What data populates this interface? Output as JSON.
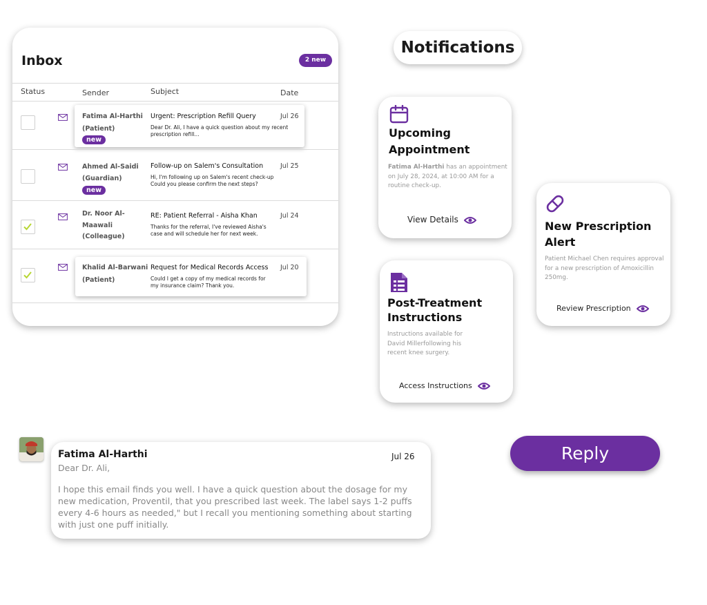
{
  "inbox": {
    "title": "Inbox",
    "badge": "2 new",
    "columns": {
      "status": "Status",
      "sender": "Sender",
      "subject": "Subject",
      "date": "Date"
    },
    "rows": [
      {
        "sender_name": "Fatima Al-Harthi",
        "sender_role": "(Patient)",
        "new_label": "new",
        "subject": "Urgent: Prescription Refill Query",
        "preview": "Dear Dr. Ali, I have a quick question about my recent prescription refill...",
        "date": "Jul 26",
        "checked": false
      },
      {
        "sender_name": "Ahmed Al-Saidi",
        "sender_role": "(Guardian)",
        "new_label": "new",
        "subject": "Follow-up on Salem's Consultation",
        "preview": "Hi, I'm following up on Salem's recent check-up Could you please confirm the next steps?",
        "date": "Jul 25",
        "checked": false
      },
      {
        "sender_name": "Dr. Noor Al-Maawali",
        "sender_role": "(Colleague)",
        "subject": "RE: Patient Referral - Aisha Khan",
        "preview": "Thanks for the referral, I've reviewed Aisha's case and will schedule her for next week.",
        "date": "Jul 24",
        "checked": true
      },
      {
        "sender_name": "Khalid Al-Barwani",
        "sender_role": "(Patient)",
        "subject": "Request for Medical Records Access",
        "preview": "Could I get a copy of my medical records for my insurance claim? Thank you.",
        "date": "Jul 20",
        "checked": true
      }
    ]
  },
  "notifications": {
    "title": "Notifications",
    "cards": [
      {
        "icon": "calendar-icon",
        "title": "Upcoming Appointment",
        "body_name": "Fatima Al-Harthi",
        "body_rest": " has an appointment on July 28, 2024, at 10:00 AM for a routine check-up.",
        "action": "View Details"
      },
      {
        "icon": "pill-icon",
        "title": "New Prescription Alert",
        "body": "Patient Michael Chen requires approval for a new prescription of Amoxicillin 250mg.",
        "action": "Review Prescription"
      },
      {
        "icon": "document-icon",
        "title": "Post-Treatment Instructions",
        "body": "Instructions available for David Millerfollowing his recent knee surgery.",
        "action": "Access Instructions"
      }
    ]
  },
  "email": {
    "sender": "Fatima Al-Harthi",
    "date": "Jul 26",
    "greeting": "Dear Dr. Ali,",
    "body": "I hope this email finds you well. I have a quick question about the dosage for my new medication, Proventil, that you prescribed last week. The label says 1-2 puffs every 4-6 hours as needed,\" but I recall you mentioning something about starting with just one puff initially."
  },
  "reply_label": "Reply",
  "colors": {
    "accent": "#6b2fa0",
    "check": "#b7d633"
  }
}
